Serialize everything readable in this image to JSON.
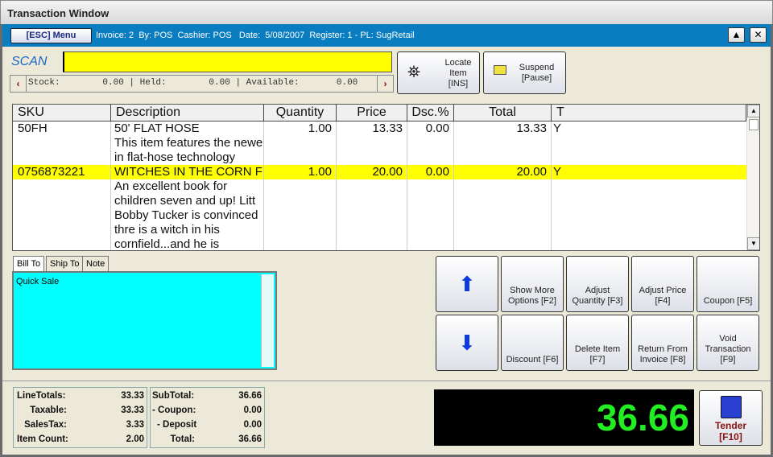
{
  "window": {
    "title": "Transaction Window"
  },
  "header": {
    "menu_label": "[ESC] Menu",
    "info": "Invoice: 2  By: POS  Cashier: POS   Date:  5/08/2007  Register: 1 - PL: SugRetail",
    "up_btn": "▲",
    "close_btn": "✕"
  },
  "scan": {
    "label": "SCAN",
    "value": "",
    "stock_text": "Stock:        0.00 | Held:        0.00 | Available:       0.00"
  },
  "buttons": {
    "locate": "Locate\nItem\n[INS]",
    "suspend": "Suspend\n[Pause]"
  },
  "grid": {
    "columns": [
      "SKU",
      "Description",
      "Quantity",
      "Price",
      "Dsc.%",
      "Total",
      "T"
    ],
    "rows": [
      {
        "sku": "50FH",
        "description": "50' FLAT HOSE",
        "quantity": "1.00",
        "price": "13.33",
        "discount": "0.00",
        "total": "13.33",
        "t": "Y",
        "notes": [
          "This item features the newe",
          "in flat-hose technology"
        ],
        "selected": false
      },
      {
        "sku": "0756873221",
        "description": "WITCHES IN THE CORN F",
        "quantity": "1.00",
        "price": "20.00",
        "discount": "0.00",
        "total": "20.00",
        "t": "Y",
        "notes": [
          "An excellent book for",
          "children seven and up!  Litt",
          "Bobby Tucker is convinced",
          "thre is a witch in his",
          "cornfield...and he is"
        ],
        "selected": true
      }
    ]
  },
  "tabs": [
    "Bill To",
    "Ship To",
    "Note"
  ],
  "note": {
    "text": "Quick Sale"
  },
  "actions": [
    "Show More\nOptions [F2]",
    "Adjust\nQuantity [F3]",
    "Adjust Price\n[F4]",
    "Coupon [F5]",
    "Discount [F6]",
    "Delete Item\n[F7]",
    "Return From\nInvoice [F8]",
    "Void\nTransaction\n[F9]"
  ],
  "totals": {
    "left": [
      {
        "label": "LineTotals:",
        "value": "33.33"
      },
      {
        "label": "Taxable:",
        "value": "33.33"
      },
      {
        "label": "SalesTax:",
        "value": "3.33"
      },
      {
        "label": "Item Count:",
        "value": "2.00"
      }
    ],
    "right": [
      {
        "label": "SubTotal:",
        "value": "36.66"
      },
      {
        "label": "- Coupon:",
        "value": "0.00"
      },
      {
        "label": "- Deposit",
        "value": "0.00"
      },
      {
        "label": "Total:",
        "value": "36.66"
      }
    ]
  },
  "display": {
    "amount": "36.66",
    "color": "#22ee22"
  },
  "tender": {
    "label": "Tender",
    "key": "[F10]"
  },
  "colors": {
    "header": "#0a7cc0",
    "scan": "#ffff00",
    "selected_row": "#ffff00",
    "note_bg": "#00ffff"
  }
}
